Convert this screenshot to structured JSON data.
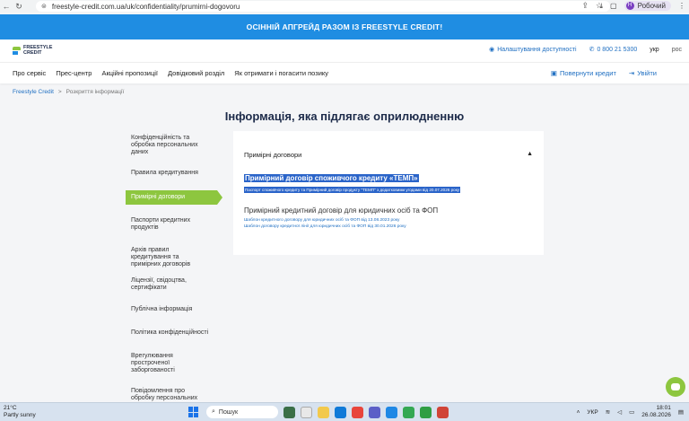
{
  "browser": {
    "url": "freestyle-credit.com.ua/uk/confidentiality/prumirni-dogovoru",
    "profile_initial": "Н",
    "profile_name": "Робочий"
  },
  "promo": {
    "text": "ОСІННІЙ АПГРЕЙД РАЗОМ ІЗ FREESTYLE CREDIT!"
  },
  "header": {
    "logo_line1": "FREESTYLE",
    "logo_line2": "CREDIT",
    "accessibility": "Налаштування доступності",
    "phone": "0 800 21 5300",
    "lang_active": "укр",
    "lang_other": "рос"
  },
  "nav": {
    "items": [
      "Про сервіс",
      "Прес-центр",
      "Акційні пропозиції",
      "Довідковий розділ",
      "Як отримати і погасити позику"
    ],
    "return_credit": "Повернути кредит",
    "login": "Увійти"
  },
  "breadcrumb": {
    "home": "Freestyle Credit",
    "sep": ">",
    "current": "Розкриття інформації"
  },
  "page": {
    "title": "Інформація, яка підлягає оприлюдненню"
  },
  "sidebar": {
    "items": [
      "Конфіденційність та обробка персональних даних",
      "Правила кредитування",
      "Примірні договори",
      "Паспорти кредитних продуктів",
      "Архів правил кредитування та примірних договорів",
      "Ліцензії, свідоцтва, сертифікати",
      "Публічна інформація",
      "Політика конфіденційності",
      "Врегулювання простроченої заборгованості",
      "Повідомлення про обробку персональних даних"
    ],
    "active_index": 2
  },
  "content": {
    "section_title": "Примірні договори",
    "doc1_title": "Примірний договір споживчого кредиту «ТЕМП»",
    "doc1_sub": "Паспорт споживчого кредиту та Примірний договір продукту \"ТЕМП\" з додатковими угодами від 20.07.2026 року",
    "doc2_title": "Примірний кредитний договір для юридичних осіб та ФОП",
    "doc2_link1": "Шаблон кредитного договору для юридичних осіб та ФОП від 13.08.2023 року",
    "doc2_link2": "Шаблон договору кредитної лінії для юридичних осіб та ФОП від 30.01.2026 року"
  },
  "taskbar": {
    "temp": "21°C",
    "weather": "Partly sunny",
    "search": "Пошук",
    "lang": "УКР",
    "time": "18:01",
    "date": "26.08.2026"
  },
  "colors": {
    "accent_green": "#8dc63f",
    "brand_blue": "#1f8de2",
    "link_blue": "#1f6fc2"
  }
}
